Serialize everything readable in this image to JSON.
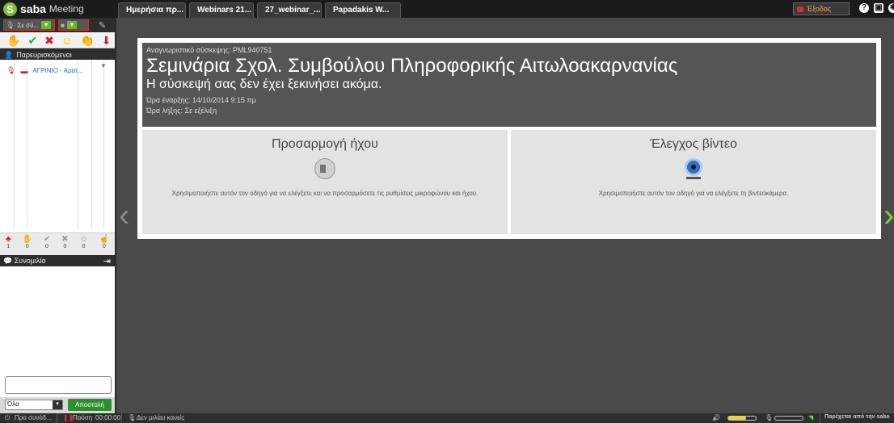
{
  "app": {
    "brand": "saba",
    "product": "Meeting"
  },
  "tabs": [
    {
      "label": "Ημερήσια πρ..."
    },
    {
      "label": "Webinars 21..."
    },
    {
      "label": "27_webinar_..."
    },
    {
      "label": "Papadakis W..."
    }
  ],
  "toolbar": {
    "exit_label": "Έξοδος"
  },
  "left_panel": {
    "audio_dropdown": "Σε σύ...",
    "attendees_header": "Παρευρισκόμενοι",
    "attendee": "ΑΓΡΙΝΙΟ - Αρατ...",
    "status_counts": [
      "1",
      "0",
      "0",
      "0",
      "0",
      "0"
    ],
    "chat_header": "Συνομιλία",
    "chat_target": "Όλα",
    "send_label": "Αποστολή"
  },
  "meeting": {
    "code_label": "Αναγνωριστικό σύσκεψης:",
    "code_value": "PML940751",
    "title": "Σεμινάρια Σχολ. Συμβούλου Πληροφορικής Αιτωλοακαρνανίας",
    "status": "Η σύσκεψή σας δεν έχει ξεκινήσει ακόμα.",
    "start_label": "Ώρα έναρξης:",
    "start_value": "14/10/2014 9:15 πμ",
    "end_label": "Ώρα λήξης:",
    "end_value": "Σε εξέλιξη"
  },
  "audio_panel": {
    "title": "Προσαρμογή ήχου",
    "text": "Χρησιμοποιήστε αυτόν τον οδηγό για να ελέγξετε και να προσαρμόσετε τις ρυθμίσεις μικροφώνου και ήχου."
  },
  "video_panel": {
    "title": "Έλεγχος βίντεο",
    "text": "Χρησιμοποιήστε αυτόν τον οδηγό για να ελέγξετε τη βιντεοκάμερα."
  },
  "bottom": {
    "connect_label": "Προ συνόδ...",
    "pause_label": "Παύση",
    "timer": "00:00:00",
    "speaking": "Δεν μιλάει κανείς",
    "provided_by": "Παρέχεται από την saba",
    "speaker_volume": 0.65,
    "mic_volume": 0
  },
  "colors": {
    "accent_green": "#7cbf3a",
    "exit_text": "#e7ad5b"
  }
}
